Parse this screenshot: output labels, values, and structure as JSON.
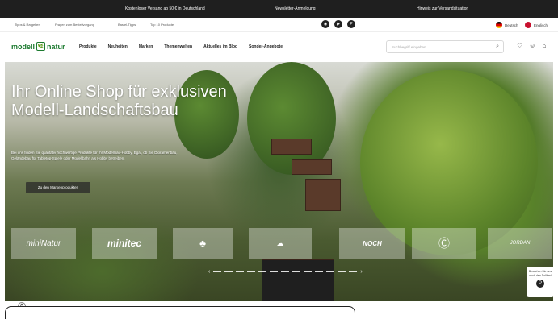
{
  "topbar": {
    "items": [
      "Kostenloser Versand ab 50 € in Deutschland",
      "Newsletter-Anmeldung",
      "Hinweis zur Versandsituation"
    ]
  },
  "metabar": {
    "links": [
      "Tipps & Ratgeber",
      "Fragen zum Bestellvorgang",
      "Bastel-Tipps",
      "Top 10 Produkte"
    ],
    "languages": [
      "Deutsch",
      "Englisch"
    ]
  },
  "header": {
    "logo": {
      "left": "modell",
      "mid": "🌿",
      "right": "natur"
    },
    "nav": [
      "Produkte",
      "Neuheiten",
      "Marken",
      "Themenwelten",
      "Aktuelles im Blog",
      "Sonder-Angebote"
    ],
    "search_placeholder": "Suchbegriff eingeben ..."
  },
  "hero": {
    "title": "Ihr Online Shop für exklusiven Modell-Landschaftsbau",
    "text": "Bei uns finden Sie qualitativ hochwertige Produkte für Ihr Modellbau-Hobby. Egal, ob Sie Dioramenbau, Geländebau für Tabletop-Spiele oder Modellbahn als Hobby betreiben.",
    "button": "Zu den Markenprodukten"
  },
  "brands": [
    "miniNatur",
    "minitec",
    "",
    "",
    "NOCH",
    "",
    "JORDAN"
  ],
  "promo": {
    "text": "Besuchen Sie uns noch den Dollbad"
  },
  "colors": {
    "accent": "#1c7a2f",
    "topbar": "#1f1f1f"
  }
}
